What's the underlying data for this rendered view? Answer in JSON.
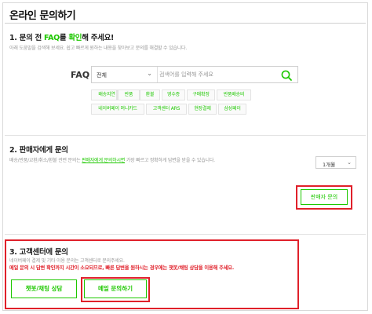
{
  "page": {
    "title": "온라인 문의하기"
  },
  "faq_section": {
    "title_prefix": "1. 문의 전 ",
    "title_faq": "FAQ",
    "title_mid": "를 ",
    "title_confirm": "확인",
    "title_suffix": "해 주세요!",
    "description": "아래 도움말을 검색해 보세요. 쉽고 빠르게 원하는 내용을 찾아보고 문의를 해결할 수 있습니다.",
    "faq_label": "FAQ",
    "category_select": "전체",
    "search_placeholder": "검색어를 입력해 주세요",
    "chips": [
      "배송지연",
      "반품",
      "환불",
      "영수증",
      "구매확정",
      "반품배송비",
      "네이버페이 머니카드",
      "고객센터 ARS",
      "현장결제",
      "삼성페이"
    ]
  },
  "seller_section": {
    "title": "2. 판매자에게 문의",
    "desc_prefix": "배송/반품/교환/취소/환불 관련 문의는 ",
    "desc_link": "판매자에게 문의하시면",
    "desc_suffix": " 가장 빠르고 정확하게 답변을 받을 수 있습니다.",
    "period_select": "1개월",
    "contact_button": "판매자 문의"
  },
  "support_section": {
    "title": "3. 고객센터에 문의",
    "description": "네이버페이 결제 및 기타 이용 문의는 고객센터로 문의주세요.",
    "warning": "메일 문의 시 답변 확인까지 시간이 소요되므로, 빠른 답변을 원하시는 경우에는 챗봇/채팅 상담을 이용해 주세요.",
    "chat_button": "챗봇/채팅 상담",
    "mail_button": "메일 문의하기"
  },
  "colors": {
    "accent": "#1ec800",
    "highlight": "#e0202a",
    "text": "#222222",
    "muted": "#999999"
  },
  "icons": {
    "search": "search-icon",
    "dropdown": "chevron-down-icon"
  }
}
